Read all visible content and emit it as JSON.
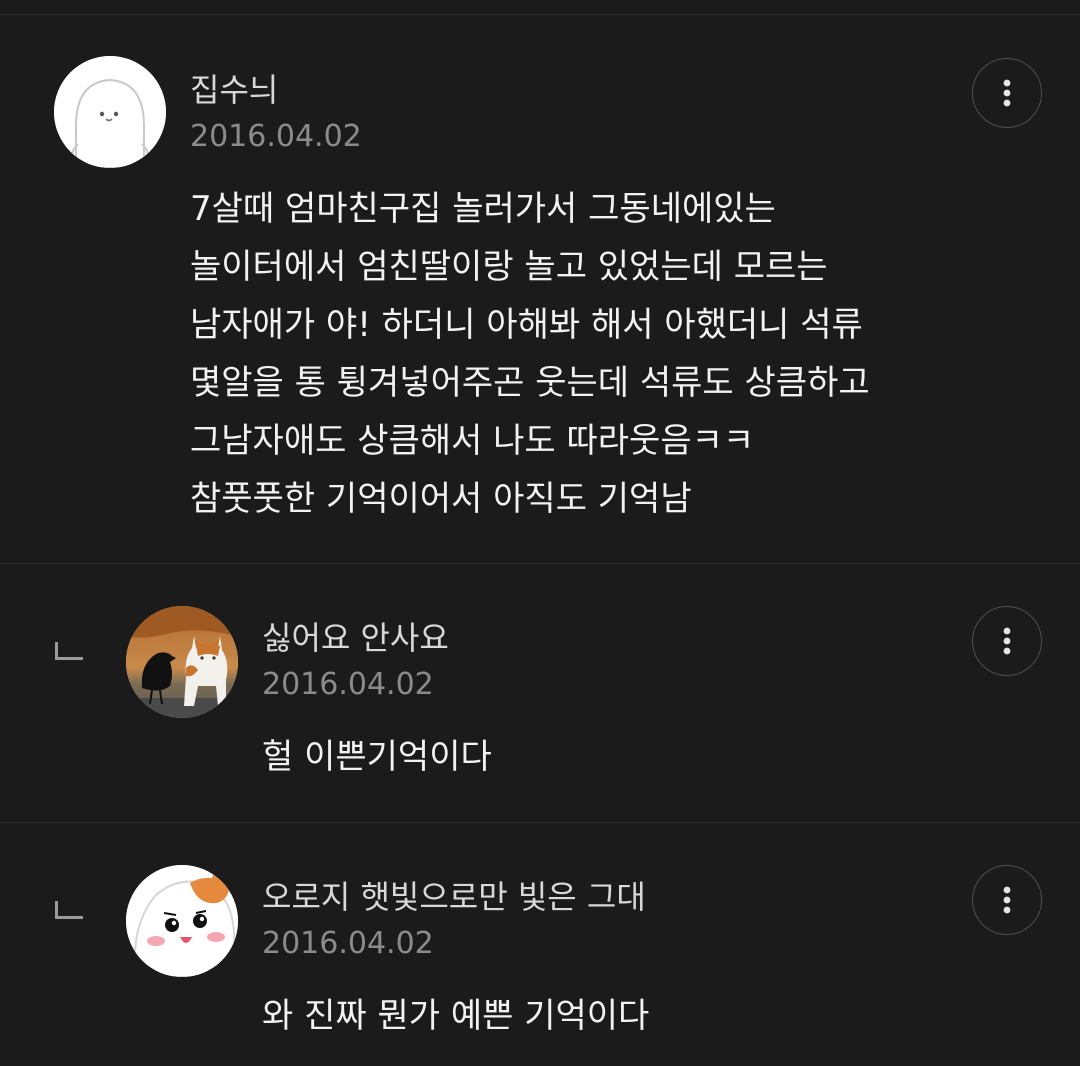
{
  "comments": [
    {
      "author": "집수늬",
      "date": "2016.04.02",
      "text": "7살때 엄마친구집 놀러가서 그동네에있는\n놀이터에서 엄친딸이랑 놀고 있었는데 모르는\n남자애가 야! 하더니 아해봐 해서 아했더니 석류\n몇알을 통 튕겨넣어주곤 웃는데 석류도 상큼하고\n그남자애도 상큼해서 나도 따라웃음ㅋㅋ\n참풋풋한 기억이어서 아직도 기억남",
      "avatar_icon": "white-blob-character-avatar",
      "more_icon": "vertical-dots-icon"
    },
    {
      "author": "싫어요 안사요",
      "date": "2016.04.02",
      "text": "헐 이쁜기억이다",
      "avatar_icon": "crow-and-cat-photo-avatar",
      "reply_icon": "reply-arrow-icon",
      "more_icon": "vertical-dots-icon"
    },
    {
      "author": "오로지 햇빛으로만 빛은 그대",
      "date": "2016.04.02",
      "text": "와 진짜 뭔가 예쁜 기억이다",
      "avatar_icon": "hamster-character-avatar",
      "reply_icon": "reply-arrow-icon",
      "more_icon": "vertical-dots-icon"
    }
  ],
  "colors": {
    "background": "#1b1b1b",
    "divider": "#2e2e2e",
    "author_text": "#d8d8d8",
    "date_text": "#8b8b8b",
    "body_text": "#f2f2f2"
  }
}
